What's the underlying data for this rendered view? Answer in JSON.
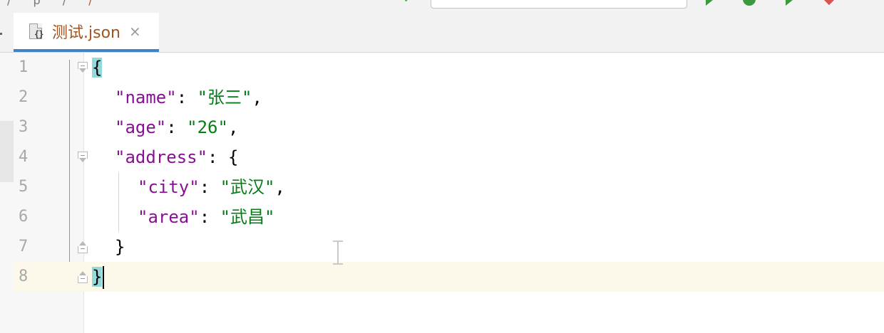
{
  "toolbar": {
    "breadcrumbs": [
      "/",
      "p",
      "/",
      "/"
    ]
  },
  "tab": {
    "title": "测试.json",
    "close_glyph": "×",
    "icon": "json-file-icon",
    "icon_glyph": "{}"
  },
  "editor": {
    "line_numbers": [
      "1",
      "2",
      "3",
      "4",
      "5",
      "6",
      "7",
      "8"
    ],
    "code": {
      "l1_brace": "{",
      "l2_key": "\"name\"",
      "l2_colon": ": ",
      "l2_value": "\"张三\"",
      "l2_comma": ",",
      "l3_key": "\"age\"",
      "l3_colon": ": ",
      "l3_value": "\"26\"",
      "l3_comma": ",",
      "l4_key": "\"address\"",
      "l4_rest": ": {",
      "l5_key": "\"city\"",
      "l5_colon": ": ",
      "l5_value": "\"武汉\"",
      "l5_comma": ",",
      "l6_key": "\"area\"",
      "l6_colon": ": ",
      "l6_value": "\"武昌\"",
      "l7_brace": "}",
      "l8_brace": "}"
    },
    "current_line": "8"
  },
  "colors": {
    "key": "#871094",
    "string": "#067d17",
    "brace_highlight": "#93d9d9",
    "tab_accent": "#4083c9",
    "tab_title": "#a3531e",
    "current_line_bg": "#fcf9ea"
  }
}
